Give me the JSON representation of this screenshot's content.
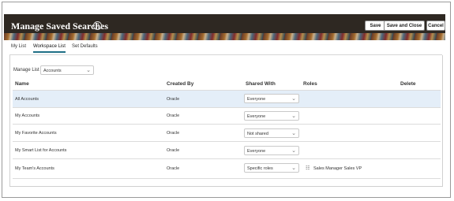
{
  "header": {
    "title": "Manage Saved Searches",
    "buttons": {
      "save": "Save",
      "save_close": "Save and Close",
      "cancel": "Cancel"
    }
  },
  "tabs": [
    {
      "label": "My List"
    },
    {
      "label": "Workspace List"
    },
    {
      "label": "Set Defaults"
    }
  ],
  "manage_list": {
    "label": "Manage List",
    "value": "Accounts"
  },
  "columns": {
    "name": "Name",
    "created_by": "Created By",
    "shared_with": "Shared With",
    "roles": "Roles",
    "delete": "Delete"
  },
  "rows": [
    {
      "name": "All Accounts",
      "created_by": "Oracle",
      "shared_with": "Everyone",
      "roles": ""
    },
    {
      "name": "My Accounts",
      "created_by": "Oracle",
      "shared_with": "Everyone",
      "roles": ""
    },
    {
      "name": "My Favorite Accounts",
      "created_by": "Oracle",
      "shared_with": "Not shared",
      "roles": ""
    },
    {
      "name": "My Smart List for Accounts",
      "created_by": "Oracle",
      "shared_with": "Everyone",
      "roles": ""
    },
    {
      "name": "My Team's Accounts",
      "created_by": "Oracle",
      "shared_with": "Specific roles",
      "roles": "Sales Manager Sales VP"
    }
  ]
}
